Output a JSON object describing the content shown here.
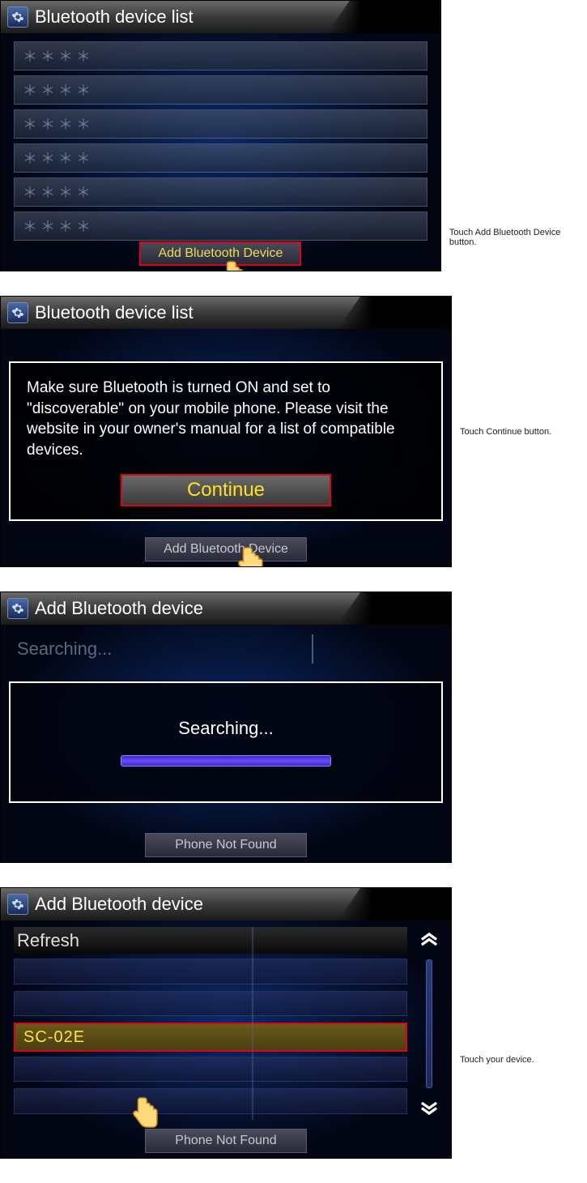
{
  "screens": {
    "s1": {
      "title": "Bluetooth device list",
      "placeholder_rows": [
        "＊＊＊＊",
        "＊＊＊＊",
        "＊＊＊＊",
        "＊＊＊＊",
        "＊＊＊＊",
        "＊＊＊＊"
      ],
      "add_btn": "Add Bluetooth Device"
    },
    "s2": {
      "title": "Bluetooth device list",
      "dialog_msg": "Make sure Bluetooth is turned ON and set to \"discoverable\" on your mobile phone. Please visit the website in your owner's manual for a list of compatible devices.",
      "continue_btn": "Continue",
      "add_btn": "Add Bluetooth Device"
    },
    "s3": {
      "title": "Add Bluetooth device",
      "bg_label": "Searching...",
      "searching_label": "Searching...",
      "not_found_btn": "Phone Not Found"
    },
    "s4": {
      "title": "Add Bluetooth device",
      "refresh_label": "Refresh",
      "device_name": "SC-02E",
      "not_found_btn": "Phone Not Found"
    }
  },
  "captions": {
    "c1": "Touch Add Bluetooth Device button.",
    "c2": "Touch Continue button.",
    "c4": "Touch your device."
  }
}
